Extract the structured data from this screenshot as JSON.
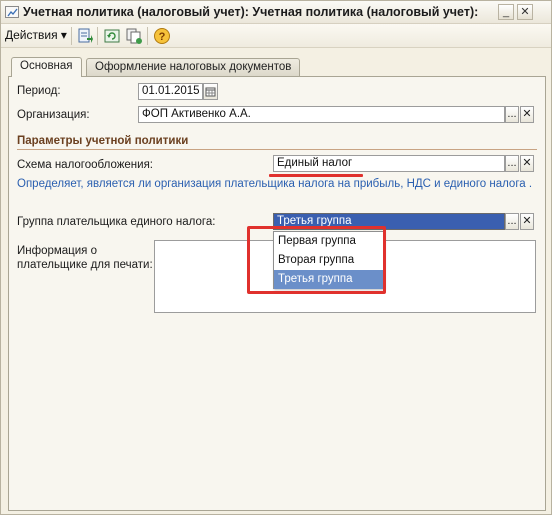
{
  "window": {
    "title": "Учетная политика (налоговый учет): Учетная политика (налоговый учет):",
    "minimize_label": "_",
    "close_label": "✕"
  },
  "toolbar": {
    "actions_label": "Действия ▾",
    "icons": [
      "post-icon",
      "refresh-icon",
      "copy-document-icon",
      "help-icon"
    ]
  },
  "tabs": [
    {
      "label": "Основная"
    },
    {
      "label": "Оформление налоговых документов"
    }
  ],
  "form": {
    "period_label": "Период:",
    "period_value": "01.01.2015",
    "org_label": "Организация:",
    "org_value": "ФОП Активенко А.А.",
    "section_title": "Параметры учетной политики",
    "tax_scheme_label": "Схема налогообложения:",
    "tax_scheme_value": "Единый налог",
    "tax_scheme_hint": "Определяет, является ли организация плательщика налога на прибыль, НДС и единого налога .",
    "group_label": "Группа плательщика единого налога:",
    "group_value": "Третья группа",
    "info_label_line1": "Информация о",
    "info_label_line2": "плательщике для печати:",
    "choose_button": "...",
    "clear_button": "✕"
  },
  "group_dropdown": {
    "options": [
      "Первая группа",
      "Вторая группа",
      "Третья группа"
    ],
    "selected": "Третья группа"
  },
  "colors": {
    "hint_text": "#2a5fb0",
    "section_title": "#6b4020",
    "selection": "#6b8fc9",
    "highlight_annotation": "#e0312d"
  }
}
